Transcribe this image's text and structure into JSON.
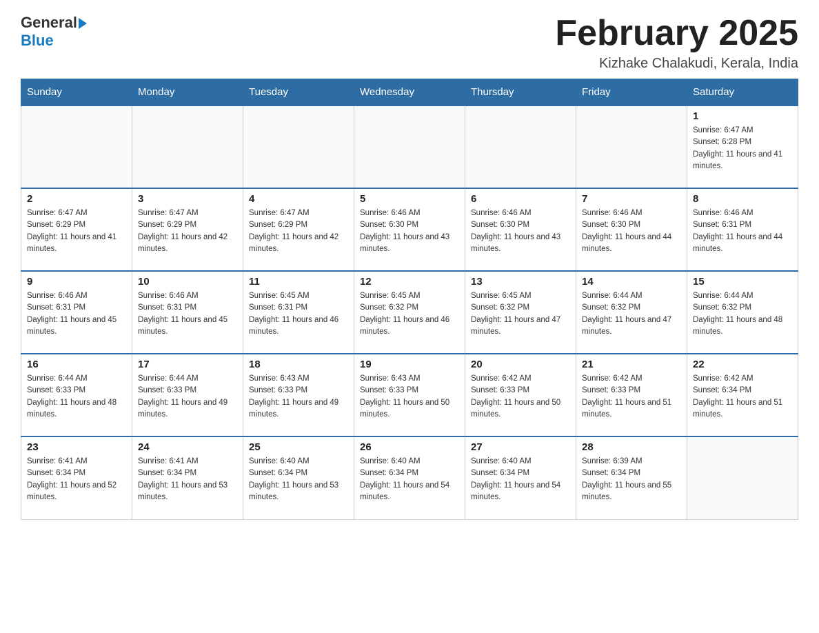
{
  "header": {
    "logo_general": "General",
    "logo_blue": "Blue",
    "month_title": "February 2025",
    "location": "Kizhake Chalakudi, Kerala, India"
  },
  "weekdays": [
    "Sunday",
    "Monday",
    "Tuesday",
    "Wednesday",
    "Thursday",
    "Friday",
    "Saturday"
  ],
  "weeks": [
    [
      {
        "day": "",
        "sunrise": "",
        "sunset": "",
        "daylight": ""
      },
      {
        "day": "",
        "sunrise": "",
        "sunset": "",
        "daylight": ""
      },
      {
        "day": "",
        "sunrise": "",
        "sunset": "",
        "daylight": ""
      },
      {
        "day": "",
        "sunrise": "",
        "sunset": "",
        "daylight": ""
      },
      {
        "day": "",
        "sunrise": "",
        "sunset": "",
        "daylight": ""
      },
      {
        "day": "",
        "sunrise": "",
        "sunset": "",
        "daylight": ""
      },
      {
        "day": "1",
        "sunrise": "Sunrise: 6:47 AM",
        "sunset": "Sunset: 6:28 PM",
        "daylight": "Daylight: 11 hours and 41 minutes."
      }
    ],
    [
      {
        "day": "2",
        "sunrise": "Sunrise: 6:47 AM",
        "sunset": "Sunset: 6:29 PM",
        "daylight": "Daylight: 11 hours and 41 minutes."
      },
      {
        "day": "3",
        "sunrise": "Sunrise: 6:47 AM",
        "sunset": "Sunset: 6:29 PM",
        "daylight": "Daylight: 11 hours and 42 minutes."
      },
      {
        "day": "4",
        "sunrise": "Sunrise: 6:47 AM",
        "sunset": "Sunset: 6:29 PM",
        "daylight": "Daylight: 11 hours and 42 minutes."
      },
      {
        "day": "5",
        "sunrise": "Sunrise: 6:46 AM",
        "sunset": "Sunset: 6:30 PM",
        "daylight": "Daylight: 11 hours and 43 minutes."
      },
      {
        "day": "6",
        "sunrise": "Sunrise: 6:46 AM",
        "sunset": "Sunset: 6:30 PM",
        "daylight": "Daylight: 11 hours and 43 minutes."
      },
      {
        "day": "7",
        "sunrise": "Sunrise: 6:46 AM",
        "sunset": "Sunset: 6:30 PM",
        "daylight": "Daylight: 11 hours and 44 minutes."
      },
      {
        "day": "8",
        "sunrise": "Sunrise: 6:46 AM",
        "sunset": "Sunset: 6:31 PM",
        "daylight": "Daylight: 11 hours and 44 minutes."
      }
    ],
    [
      {
        "day": "9",
        "sunrise": "Sunrise: 6:46 AM",
        "sunset": "Sunset: 6:31 PM",
        "daylight": "Daylight: 11 hours and 45 minutes."
      },
      {
        "day": "10",
        "sunrise": "Sunrise: 6:46 AM",
        "sunset": "Sunset: 6:31 PM",
        "daylight": "Daylight: 11 hours and 45 minutes."
      },
      {
        "day": "11",
        "sunrise": "Sunrise: 6:45 AM",
        "sunset": "Sunset: 6:31 PM",
        "daylight": "Daylight: 11 hours and 46 minutes."
      },
      {
        "day": "12",
        "sunrise": "Sunrise: 6:45 AM",
        "sunset": "Sunset: 6:32 PM",
        "daylight": "Daylight: 11 hours and 46 minutes."
      },
      {
        "day": "13",
        "sunrise": "Sunrise: 6:45 AM",
        "sunset": "Sunset: 6:32 PM",
        "daylight": "Daylight: 11 hours and 47 minutes."
      },
      {
        "day": "14",
        "sunrise": "Sunrise: 6:44 AM",
        "sunset": "Sunset: 6:32 PM",
        "daylight": "Daylight: 11 hours and 47 minutes."
      },
      {
        "day": "15",
        "sunrise": "Sunrise: 6:44 AM",
        "sunset": "Sunset: 6:32 PM",
        "daylight": "Daylight: 11 hours and 48 minutes."
      }
    ],
    [
      {
        "day": "16",
        "sunrise": "Sunrise: 6:44 AM",
        "sunset": "Sunset: 6:33 PM",
        "daylight": "Daylight: 11 hours and 48 minutes."
      },
      {
        "day": "17",
        "sunrise": "Sunrise: 6:44 AM",
        "sunset": "Sunset: 6:33 PM",
        "daylight": "Daylight: 11 hours and 49 minutes."
      },
      {
        "day": "18",
        "sunrise": "Sunrise: 6:43 AM",
        "sunset": "Sunset: 6:33 PM",
        "daylight": "Daylight: 11 hours and 49 minutes."
      },
      {
        "day": "19",
        "sunrise": "Sunrise: 6:43 AM",
        "sunset": "Sunset: 6:33 PM",
        "daylight": "Daylight: 11 hours and 50 minutes."
      },
      {
        "day": "20",
        "sunrise": "Sunrise: 6:42 AM",
        "sunset": "Sunset: 6:33 PM",
        "daylight": "Daylight: 11 hours and 50 minutes."
      },
      {
        "day": "21",
        "sunrise": "Sunrise: 6:42 AM",
        "sunset": "Sunset: 6:33 PM",
        "daylight": "Daylight: 11 hours and 51 minutes."
      },
      {
        "day": "22",
        "sunrise": "Sunrise: 6:42 AM",
        "sunset": "Sunset: 6:34 PM",
        "daylight": "Daylight: 11 hours and 51 minutes."
      }
    ],
    [
      {
        "day": "23",
        "sunrise": "Sunrise: 6:41 AM",
        "sunset": "Sunset: 6:34 PM",
        "daylight": "Daylight: 11 hours and 52 minutes."
      },
      {
        "day": "24",
        "sunrise": "Sunrise: 6:41 AM",
        "sunset": "Sunset: 6:34 PM",
        "daylight": "Daylight: 11 hours and 53 minutes."
      },
      {
        "day": "25",
        "sunrise": "Sunrise: 6:40 AM",
        "sunset": "Sunset: 6:34 PM",
        "daylight": "Daylight: 11 hours and 53 minutes."
      },
      {
        "day": "26",
        "sunrise": "Sunrise: 6:40 AM",
        "sunset": "Sunset: 6:34 PM",
        "daylight": "Daylight: 11 hours and 54 minutes."
      },
      {
        "day": "27",
        "sunrise": "Sunrise: 6:40 AM",
        "sunset": "Sunset: 6:34 PM",
        "daylight": "Daylight: 11 hours and 54 minutes."
      },
      {
        "day": "28",
        "sunrise": "Sunrise: 6:39 AM",
        "sunset": "Sunset: 6:34 PM",
        "daylight": "Daylight: 11 hours and 55 minutes."
      },
      {
        "day": "",
        "sunrise": "",
        "sunset": "",
        "daylight": ""
      }
    ]
  ]
}
